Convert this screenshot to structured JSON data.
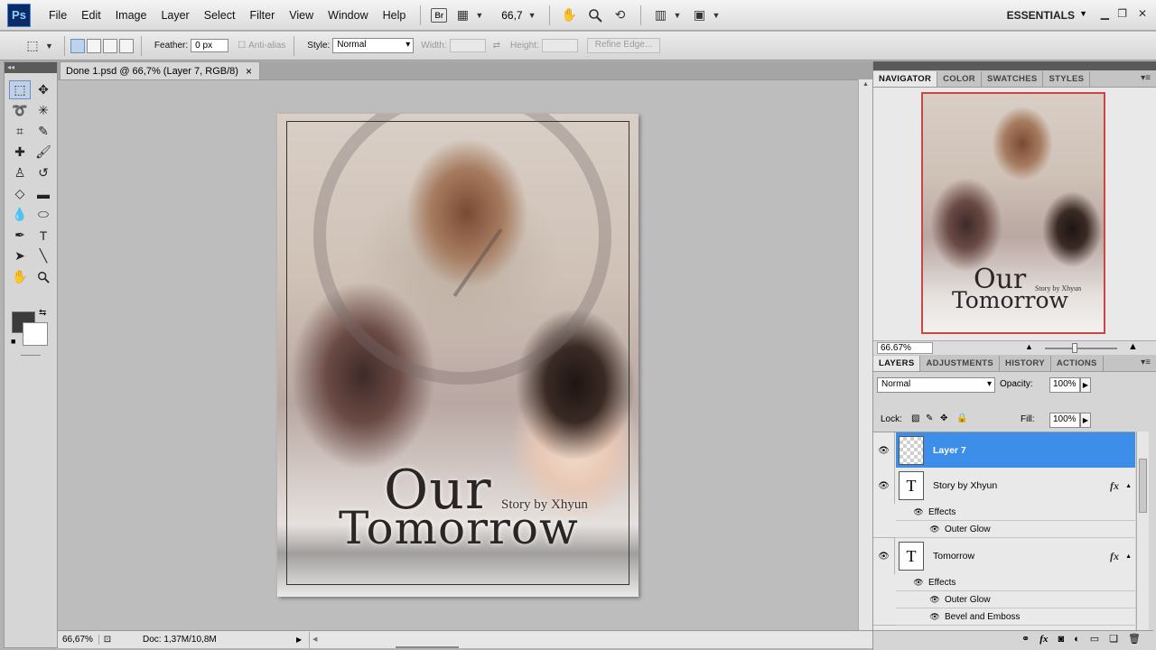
{
  "app": {
    "logo": "Ps",
    "menu": [
      "File",
      "Edit",
      "Image",
      "Layer",
      "Select",
      "Filter",
      "View",
      "Window",
      "Help"
    ],
    "bridge_label": "Br",
    "zoom": "66,7",
    "workspace": "ESSENTIALS"
  },
  "options": {
    "feather_label": "Feather:",
    "feather_value": "0 px",
    "antialias_label": "Anti-alias",
    "style_label": "Style:",
    "style_value": "Normal",
    "width_label": "Width:",
    "height_label": "Height:",
    "refine_edge": "Refine Edge..."
  },
  "document": {
    "tab_title": "Done 1.psd @ 66,7% (Layer 7, RGB/8)",
    "close_glyph": "×",
    "status_zoom": "66,67%",
    "status_doc": "Doc: 1,37M/10,8M"
  },
  "artwork": {
    "title_line1": "Our",
    "title_line2": "Tomorrow",
    "byline": "Story by Xhyun"
  },
  "navigator": {
    "tabs": [
      "NAVIGATOR",
      "COLOR",
      "SWATCHES",
      "STYLES"
    ],
    "zoom_value": "66.67%"
  },
  "layers_panel": {
    "tabs": [
      "LAYERS",
      "ADJUSTMENTS",
      "HISTORY",
      "ACTIONS"
    ],
    "blend_mode": "Normal",
    "opacity_label": "Opacity:",
    "opacity_value": "100%",
    "lock_label": "Lock:",
    "fill_label": "Fill:",
    "fill_value": "100%",
    "layers": [
      {
        "name": "Layer 7",
        "type": "raster",
        "selected": true
      },
      {
        "name": "Story by Xhyun",
        "type": "text",
        "thumb": "T",
        "fx": "fx",
        "effects_label": "Effects",
        "effects": [
          "Outer Glow"
        ]
      },
      {
        "name": "Tomorrow",
        "type": "text",
        "thumb": "T",
        "fx": "fx",
        "effects_label": "Effects",
        "effects": [
          "Outer Glow",
          "Bevel and Emboss"
        ]
      }
    ]
  },
  "colors": {
    "foreground": "#3b3b3b",
    "background": "#ffffff",
    "selection": "#3d8ee8"
  }
}
